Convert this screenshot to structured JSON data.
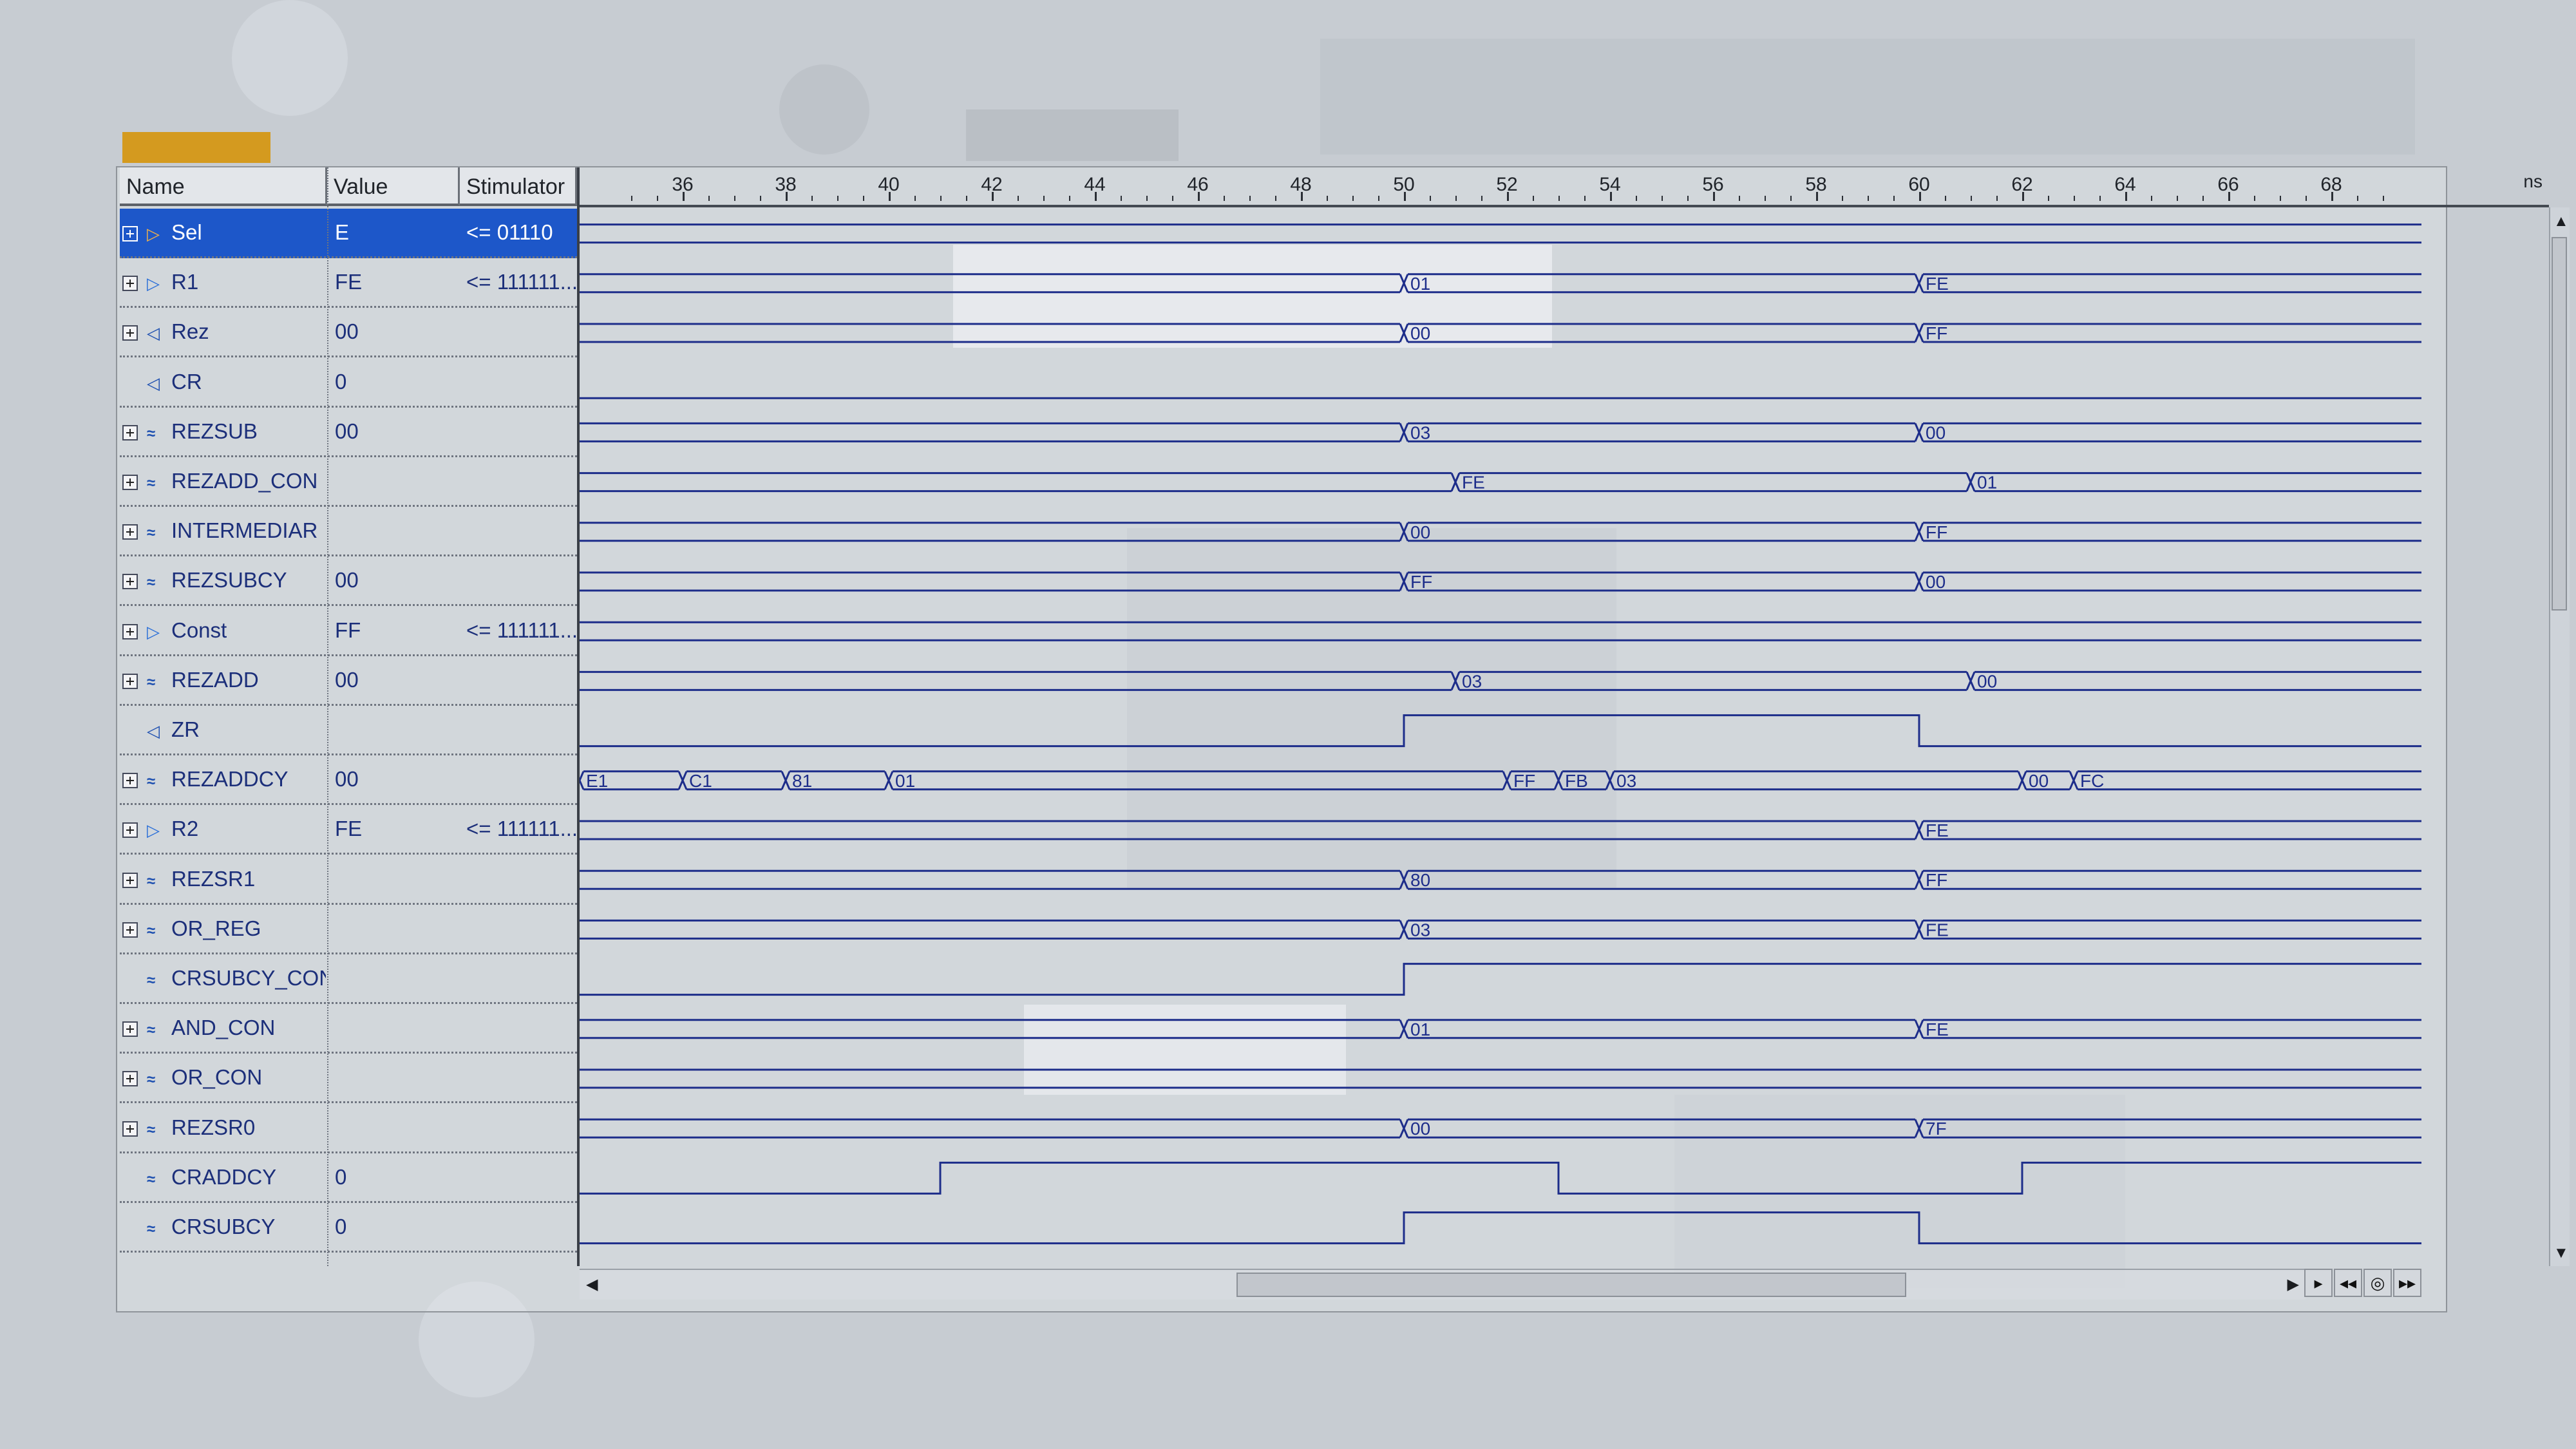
{
  "columns": {
    "name": "Name",
    "value": "Value",
    "stimulator": "Stimulator"
  },
  "ruler": {
    "unit": "ns",
    "labels": [
      36,
      38,
      40,
      42,
      44,
      46,
      48,
      50,
      52,
      54,
      56,
      58,
      60,
      62,
      64,
      66,
      68
    ]
  },
  "signals": [
    {
      "name": "Sel",
      "value": "E",
      "stimulator": "<= 01110",
      "icon": "input-port-icon",
      "expandable": true,
      "selected": true
    },
    {
      "name": "R1",
      "value": "FE",
      "stimulator": "<= 111111...",
      "icon": "input-port-icon",
      "expandable": true
    },
    {
      "name": "Rez",
      "value": "00",
      "stimulator": "",
      "icon": "output-port-icon",
      "expandable": true
    },
    {
      "name": "CR",
      "value": "0",
      "stimulator": "",
      "icon": "output-port-icon",
      "expandable": false
    },
    {
      "name": "REZSUB",
      "value": "00",
      "stimulator": "",
      "icon": "internal-signal-icon",
      "expandable": true
    },
    {
      "name": "REZADD_CON",
      "value": "",
      "stimulator": "",
      "icon": "internal-signal-icon",
      "expandable": true
    },
    {
      "name": "INTERMEDIAR",
      "value": "",
      "stimulator": "",
      "icon": "internal-signal-icon",
      "expandable": true
    },
    {
      "name": "REZSUBCY",
      "value": "00",
      "stimulator": "",
      "icon": "internal-signal-icon",
      "expandable": true
    },
    {
      "name": "Const",
      "value": "FF",
      "stimulator": "<= 111111...",
      "icon": "input-port-icon",
      "expandable": true
    },
    {
      "name": "REZADD",
      "value": "00",
      "stimulator": "",
      "icon": "internal-signal-icon",
      "expandable": true
    },
    {
      "name": "ZR",
      "value": "",
      "stimulator": "",
      "icon": "output-port-icon",
      "expandable": false
    },
    {
      "name": "REZADDCY",
      "value": "00",
      "stimulator": "",
      "icon": "internal-signal-icon",
      "expandable": true
    },
    {
      "name": "R2",
      "value": "FE",
      "stimulator": "<= 111111...",
      "icon": "input-port-icon",
      "expandable": true
    },
    {
      "name": "REZSR1",
      "value": "",
      "stimulator": "",
      "icon": "internal-signal-icon",
      "expandable": true
    },
    {
      "name": "OR_REG",
      "value": "",
      "stimulator": "",
      "icon": "internal-signal-icon",
      "expandable": true
    },
    {
      "name": "CRSUBCY_CON",
      "value": "",
      "stimulator": "",
      "icon": "internal-signal-icon",
      "expandable": false
    },
    {
      "name": "AND_CON",
      "value": "",
      "stimulator": "",
      "icon": "internal-signal-icon",
      "expandable": true
    },
    {
      "name": "OR_CON",
      "value": "",
      "stimulator": "",
      "icon": "internal-signal-icon",
      "expandable": true
    },
    {
      "name": "REZSR0",
      "value": "",
      "stimulator": "",
      "icon": "internal-signal-icon",
      "expandable": true
    },
    {
      "name": "CRADDCY",
      "value": "0",
      "stimulator": "",
      "icon": "internal-signal-icon",
      "expandable": false
    },
    {
      "name": "CRSUBCY",
      "value": "0",
      "stimulator": "",
      "icon": "internal-signal-icon",
      "expandable": false
    }
  ],
  "waveforms": [
    {
      "type": "bus",
      "segments": []
    },
    {
      "type": "bus",
      "segments": [
        {
          "t": 50,
          "label": "01"
        },
        {
          "t": 60,
          "label": "FE"
        }
      ]
    },
    {
      "type": "bus",
      "segments": [
        {
          "t": 50,
          "label": "00"
        },
        {
          "t": 60,
          "label": "FF"
        }
      ]
    },
    {
      "type": "bit",
      "initial": 0,
      "edges": []
    },
    {
      "type": "bus",
      "segments": [
        {
          "t": 50,
          "label": "03"
        },
        {
          "t": 60,
          "label": "00"
        }
      ]
    },
    {
      "type": "bus",
      "segments": [
        {
          "t": 51,
          "label": "FE"
        },
        {
          "t": 61,
          "label": "01"
        }
      ]
    },
    {
      "type": "bus",
      "segments": [
        {
          "t": 50,
          "label": "00"
        },
        {
          "t": 60,
          "label": "FF"
        }
      ]
    },
    {
      "type": "bus",
      "segments": [
        {
          "t": 50,
          "label": "FF"
        },
        {
          "t": 60,
          "label": "00"
        }
      ]
    },
    {
      "type": "bus",
      "segments": []
    },
    {
      "type": "bus",
      "segments": [
        {
          "t": 51,
          "label": "03"
        },
        {
          "t": 61,
          "label": "00"
        }
      ]
    },
    {
      "type": "bit",
      "initial": 0,
      "edges": [
        50,
        60
      ]
    },
    {
      "type": "bus",
      "segments": [
        {
          "t": 34,
          "label": "E1"
        },
        {
          "t": 36,
          "label": "C1"
        },
        {
          "t": 38,
          "label": "81"
        },
        {
          "t": 40,
          "label": "01"
        },
        {
          "t": 52,
          "label": "FF"
        },
        {
          "t": 53,
          "label": "FB"
        },
        {
          "t": 54,
          "label": "03"
        },
        {
          "t": 62,
          "label": "00"
        },
        {
          "t": 63,
          "label": "FC"
        }
      ]
    },
    {
      "type": "bus",
      "segments": [
        {
          "t": 60,
          "label": "FE"
        }
      ]
    },
    {
      "type": "bus",
      "segments": [
        {
          "t": 50,
          "label": "80"
        },
        {
          "t": 60,
          "label": "FF"
        }
      ]
    },
    {
      "type": "bus",
      "segments": [
        {
          "t": 50,
          "label": "03"
        },
        {
          "t": 60,
          "label": "FE"
        }
      ]
    },
    {
      "type": "bit",
      "initial": 0,
      "edges": [
        50
      ]
    },
    {
      "type": "bus",
      "segments": [
        {
          "t": 50,
          "label": "01"
        },
        {
          "t": 60,
          "label": "FE"
        }
      ]
    },
    {
      "type": "bus",
      "segments": []
    },
    {
      "type": "bus",
      "segments": [
        {
          "t": 50,
          "label": "00"
        },
        {
          "t": 60,
          "label": "7F"
        }
      ]
    },
    {
      "type": "bit",
      "initial": 0,
      "edges": [
        41,
        53,
        62
      ]
    },
    {
      "type": "bit",
      "initial": 0,
      "edges": [
        50,
        60
      ]
    }
  ],
  "colors": {
    "wave": "#1d2d8a",
    "selected": "#1d57c9",
    "accent": "#d49a1f"
  }
}
